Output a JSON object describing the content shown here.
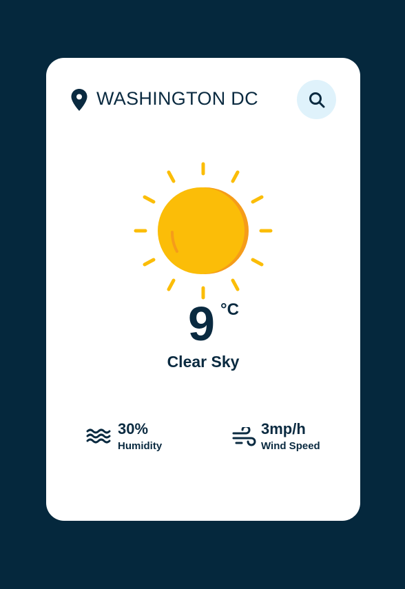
{
  "header": {
    "location_icon": "map-pin-icon",
    "city": "WASHINGTON DC",
    "search_icon": "search-icon"
  },
  "weather": {
    "icon": "sun-icon",
    "temperature": "9",
    "unit": "°C",
    "condition": "Clear Sky"
  },
  "stats": {
    "humidity": {
      "icon": "waves-icon",
      "value": "30%",
      "label": "Humidity"
    },
    "wind": {
      "icon": "wind-icon",
      "value": "3mp/h",
      "label": "Wind Speed"
    }
  },
  "colors": {
    "background": "#05283d",
    "card": "#ffffff",
    "text": "#0a2a40",
    "search_bg": "#dff2fb",
    "sun": "#fbbd08",
    "sun_shade": "#f59c1a"
  }
}
